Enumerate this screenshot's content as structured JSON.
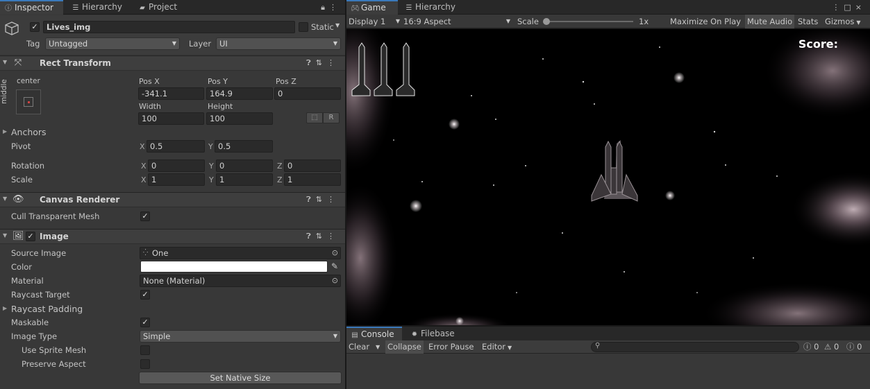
{
  "inspector": {
    "tabs": [
      {
        "label": "Inspector",
        "icon": "info-icon"
      },
      {
        "label": "Hierarchy",
        "icon": "list-icon"
      },
      {
        "label": "Project",
        "icon": "folder-icon"
      }
    ],
    "object": {
      "name": "Lives_img",
      "active": true,
      "static_label": "Static",
      "tag_label": "Tag",
      "tag_value": "Untagged",
      "layer_label": "Layer",
      "layer_value": "UI"
    },
    "rect_transform": {
      "title": "Rect Transform",
      "anchor_h": "center",
      "anchor_v": "middle",
      "pos_x_label": "Pos X",
      "pos_y_label": "Pos Y",
      "pos_z_label": "Pos Z",
      "pos_x": "-341.1",
      "pos_y": "164.9",
      "pos_z": "0",
      "width_label": "Width",
      "height_label": "Height",
      "width": "100",
      "height": "100",
      "r_button": "R",
      "anchors_label": "Anchors",
      "pivot_label": "Pivot",
      "pivot_x": "0.5",
      "pivot_y": "0.5",
      "rotation_label": "Rotation",
      "rot_x": "0",
      "rot_y": "0",
      "rot_z": "0",
      "scale_label": "Scale",
      "scale_x": "1",
      "scale_y": "1",
      "scale_z": "1",
      "axis_x": "X",
      "axis_y": "Y",
      "axis_z": "Z"
    },
    "canvas_renderer": {
      "title": "Canvas Renderer",
      "cull_label": "Cull Transparent Mesh",
      "cull": true
    },
    "image": {
      "title": "Image",
      "enabled": true,
      "source_image_label": "Source Image",
      "source_image": "One",
      "color_label": "Color",
      "color_value": "#ffffff",
      "material_label": "Material",
      "material": "None (Material)",
      "raycast_target_label": "Raycast Target",
      "raycast_target": true,
      "raycast_padding_label": "Raycast Padding",
      "maskable_label": "Maskable",
      "maskable": true,
      "image_type_label": "Image Type",
      "image_type": "Simple",
      "use_sprite_mesh_label": "Use Sprite Mesh",
      "use_sprite_mesh": false,
      "preserve_aspect_label": "Preserve Aspect",
      "preserve_aspect": false,
      "set_native_size": "Set Native Size"
    }
  },
  "game": {
    "tabs": [
      {
        "label": "Game",
        "icon": "gamepad-icon"
      },
      {
        "label": "Hierarchy",
        "icon": "list-icon"
      }
    ],
    "toolbar": {
      "display": "Display 1",
      "aspect": "16:9 Aspect",
      "scale_label": "Scale",
      "scale_value": "1x",
      "maximize": "Maximize On Play",
      "mute": "Mute Audio",
      "stats": "Stats",
      "gizmos": "Gizmos"
    },
    "hud_score": "Score:"
  },
  "console": {
    "tabs": [
      {
        "label": "Console",
        "icon": "console-icon"
      },
      {
        "label": "Filebase",
        "icon": "filebase-icon"
      }
    ],
    "clear": "Clear",
    "collapse": "Collapse",
    "error_pause": "Error Pause",
    "editor": "Editor",
    "search_placeholder": "",
    "info_count": "0",
    "warning_count": "0",
    "error_count": "0"
  },
  "colors": {
    "accent": "#3a79bb",
    "panel_bg": "#383838",
    "tab_bg": "#282828"
  }
}
